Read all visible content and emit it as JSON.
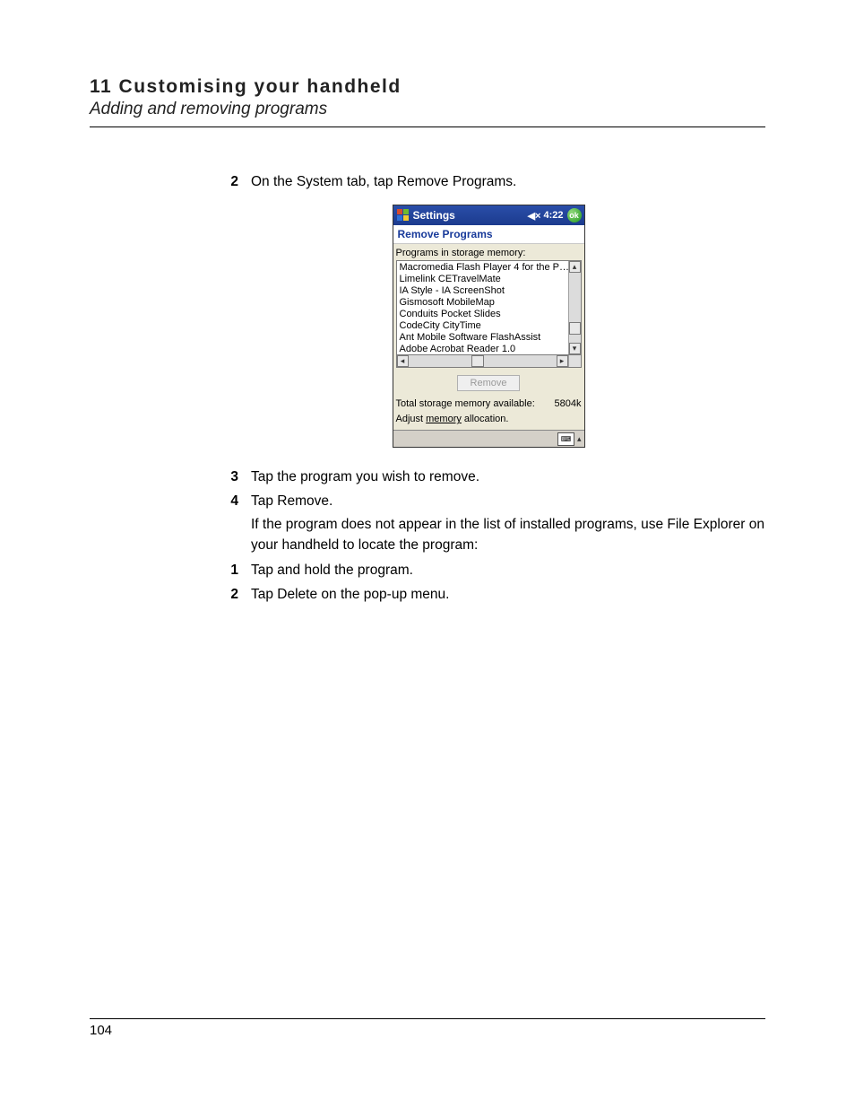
{
  "header": {
    "chapter": "11 Customising your handheld",
    "section": "Adding and removing programs"
  },
  "steps_a": [
    {
      "n": "2",
      "t": "On the System tab, tap Remove Programs."
    }
  ],
  "steps_b": [
    {
      "n": "3",
      "t": "Tap the program you wish to remove."
    },
    {
      "n": "4",
      "t": "Tap Remove."
    }
  ],
  "note": "If the program does not appear in the list of installed programs, use File Explorer on your handheld to locate the program:",
  "steps_c": [
    {
      "n": "1",
      "t": "Tap and hold the program."
    },
    {
      "n": "2",
      "t": "Tap Delete on the pop-up menu."
    }
  ],
  "device": {
    "title": "Settings",
    "time": "4:22",
    "ok": "ok",
    "subtitle": "Remove Programs",
    "label_programs": "Programs in storage memory:",
    "programs": [
      "Macromedia Flash Player 4 for the P…",
      "Limelink CETravelMate",
      "IA Style - IA ScreenShot",
      "Gismosoft MobileMap",
      "Conduits Pocket Slides",
      "CodeCity CityTime",
      "Ant Mobile Software FlashAssist",
      "Adobe Acrobat Reader 1.0"
    ],
    "remove_btn": "Remove",
    "mem_label": "Total storage memory available:",
    "mem_value": "5804k",
    "adjust_pre": "Adjust ",
    "adjust_link": "memory",
    "adjust_post": " allocation."
  },
  "page_number": "104"
}
